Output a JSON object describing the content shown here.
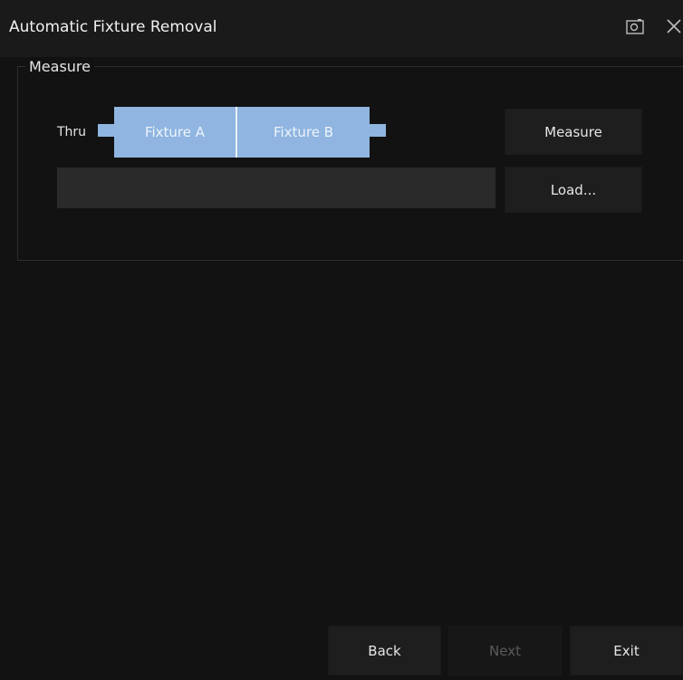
{
  "window": {
    "title": "Automatic Fixture Removal",
    "icons": [
      "camera-icon",
      "close-icon"
    ]
  },
  "measure_group": {
    "label": "Measure",
    "thru_label": "Thru",
    "fixture_a_label": "Fixture A",
    "fixture_b_label": "Fixture B",
    "fixture_color": "#8fb5e0",
    "file_field_value": "",
    "measure_button": "Measure",
    "load_button": "Load..."
  },
  "footer": {
    "back_button": "Back",
    "next_button": "Next",
    "next_enabled": false,
    "exit_button": "Exit"
  }
}
